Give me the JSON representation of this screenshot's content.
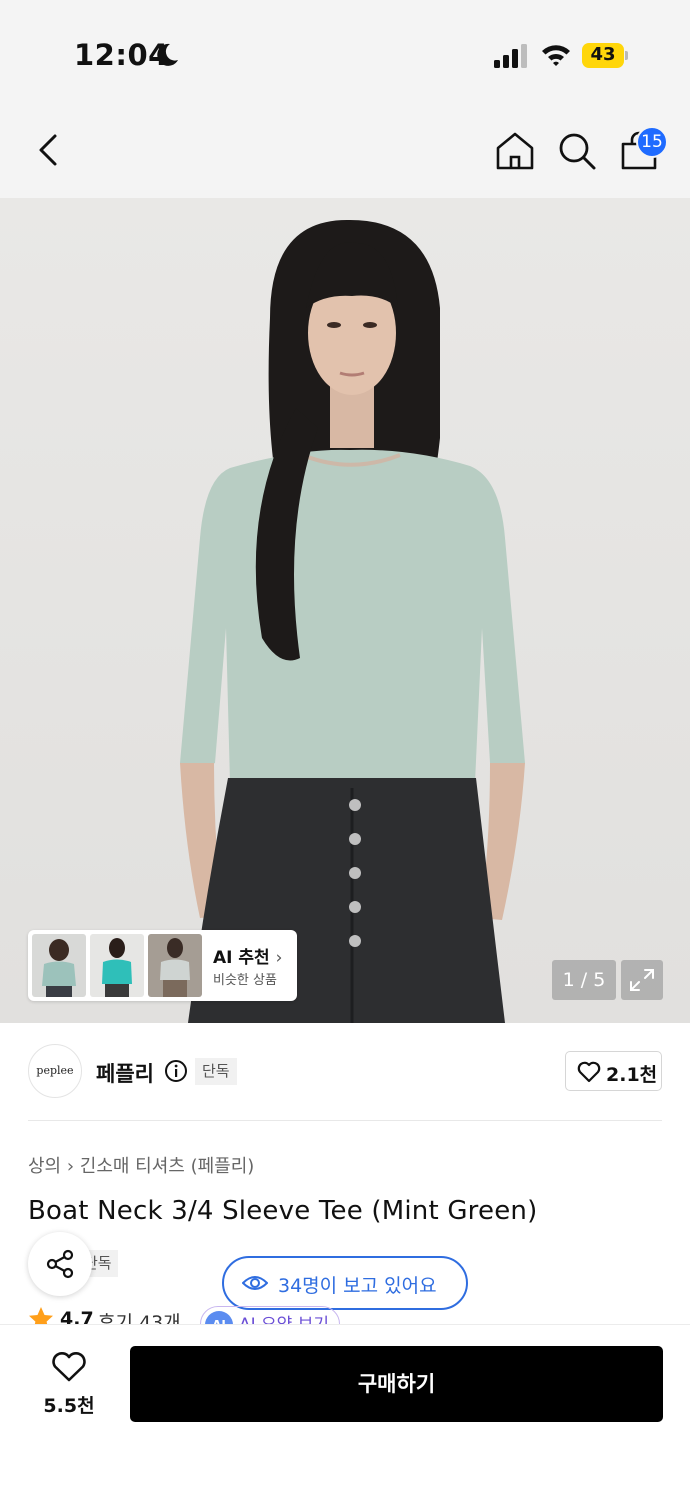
{
  "status_bar": {
    "time": "12:04",
    "battery": "43"
  },
  "nav": {
    "cart_count": "15"
  },
  "gallery": {
    "ai_title": "AI 추천",
    "ai_subtitle": "비슷한 상품",
    "counter": "1 / 5"
  },
  "brand": {
    "logo_text": "peplee",
    "name": "페플리",
    "exclusive_tag": "단독",
    "like_count": "2.1천"
  },
  "product": {
    "breadcrumb": [
      "상의",
      "긴소매 티셔츠 (페플리)"
    ],
    "title": "Boat Neck 3/4 Sleeve Tee (Mint Green)",
    "exclusive_tag": "단독",
    "viewing": "34명이 보고 있어요",
    "rating": "4.7",
    "reviews": "후기 43개",
    "ai_badge": "AI",
    "ai_summary": "AI 요약 보기"
  },
  "bottom_bar": {
    "wish_count": "5.5천",
    "buy_label": "구매하기"
  }
}
